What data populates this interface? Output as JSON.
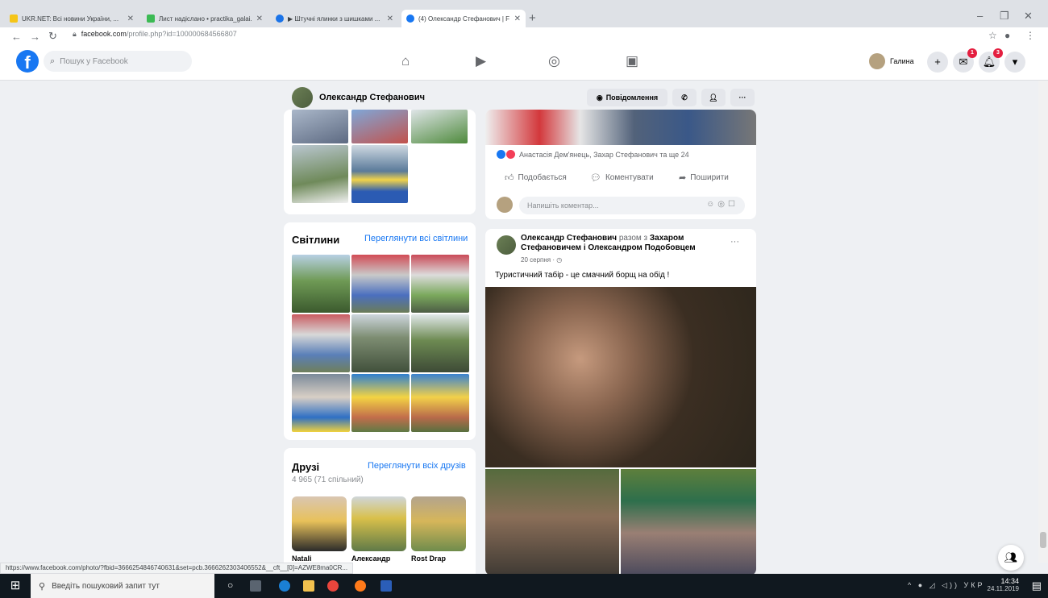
{
  "browser": {
    "tabs": [
      {
        "title": "UKR.NET: Всі новини України, ...",
        "favicon_color": "#f5c518"
      },
      {
        "title": "Лист надіслано • practika_galai...",
        "favicon_color": "#3cba54"
      },
      {
        "title": "▶ Штучні ялинки з шишками ...",
        "favicon_color": "#1a73e8"
      },
      {
        "title": "(4) Олександр Стефанович | Fa...",
        "favicon_color": "#1877f2"
      }
    ],
    "new_tab": "+",
    "url_host": "facebook.com",
    "url_path": "/profile.php?id=100000684566807",
    "status_url": "https://www.facebook.com/photo/?fbid=3666254846740631&set=pcb.3666262303406552&__cft__[0]=AZWE8ma0CR..."
  },
  "facebook": {
    "search_placeholder": "Пошук у Facebook",
    "profile_name": "Галина",
    "badges": {
      "messenger": "1",
      "notifications": "3"
    },
    "accent": "#1877f2"
  },
  "header": {
    "name": "Олександр Стефанович",
    "message_button": "Повідомлення"
  },
  "post_actions": {
    "reactions_text": "Анастасія Дем'янець, Захар Стефанович та ще 24",
    "like": "Подобається",
    "comment": "Коментувати",
    "share": "Поширити",
    "comment_placeholder": "Напишіть коментар..."
  },
  "photos": {
    "title": "Світлини",
    "link": "Переглянути всі світлини"
  },
  "friends": {
    "title": "Друзі",
    "link": "Переглянути всіх друзів",
    "count": "4 965 (71 спільний)",
    "items": [
      {
        "name": "Natali"
      },
      {
        "name": "Александр"
      },
      {
        "name": "Rost Drap"
      }
    ]
  },
  "post": {
    "author": "Олександр Стефанович",
    "with_word": "разом з",
    "tagged": "Захаром Стефановичем і Олександром Подобовцем",
    "date": "20 серпня · ◷",
    "text": "Туристичний табір - це смачний борщ на обід !"
  },
  "taskbar": {
    "search_placeholder": "Введіть пошуковий запит тут",
    "lang": "УКР",
    "time": "14:34",
    "date": "24.11.2019"
  }
}
